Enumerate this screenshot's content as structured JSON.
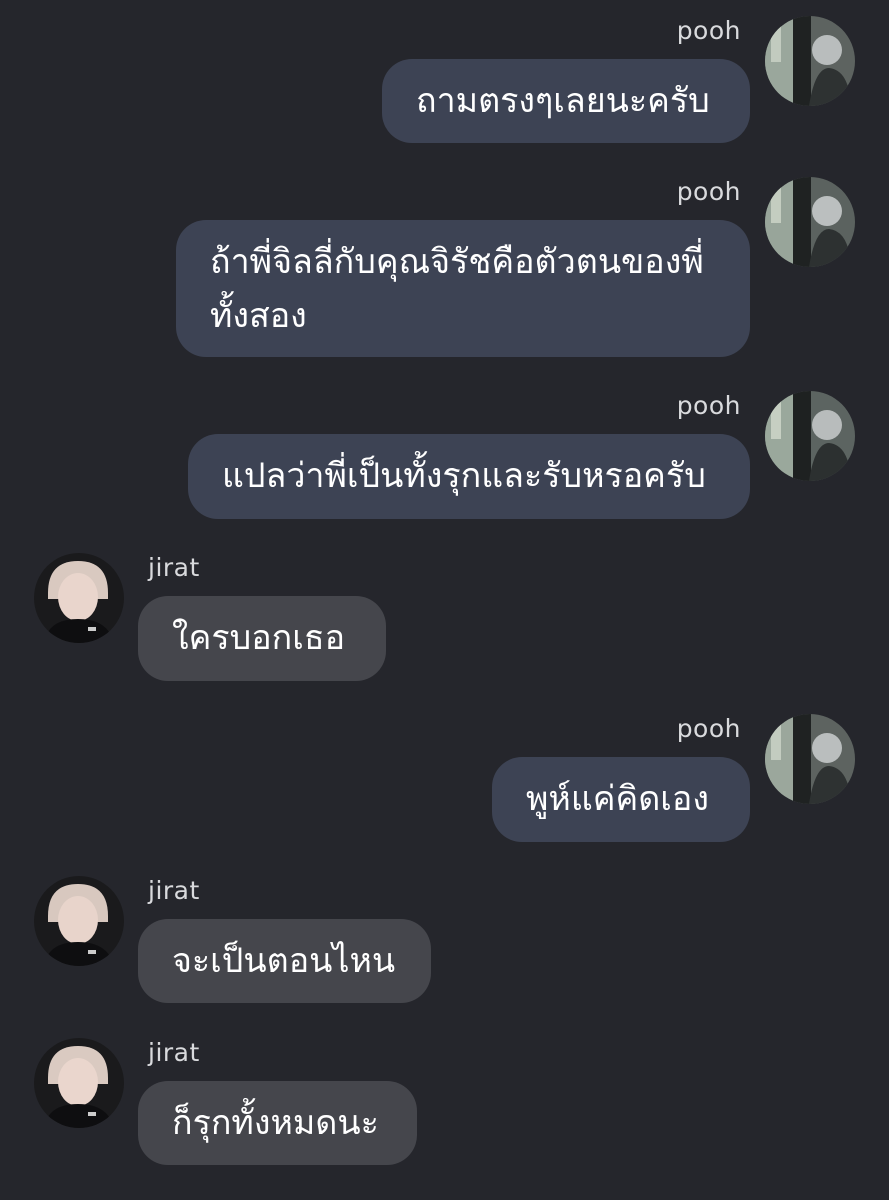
{
  "messages": [
    {
      "sender": "pooh",
      "direction": "out",
      "text": "ถามตรงๆเลยนะครับ"
    },
    {
      "sender": "pooh",
      "direction": "out",
      "text": "ถ้าพี่จิลลี่กับคุณจิรัชคือตัวตนของพี่ทั้งสอง"
    },
    {
      "sender": "pooh",
      "direction": "out",
      "text": "แปลว่าพี่เป็นทั้งรุกและรับหรอครับ"
    },
    {
      "sender": "jirat",
      "direction": "in",
      "text": "ใครบอกเธอ"
    },
    {
      "sender": "pooh",
      "direction": "out",
      "text": "พูห์แค่คิดเอง"
    },
    {
      "sender": "jirat",
      "direction": "in",
      "text": "จะเป็นตอนไหน"
    },
    {
      "sender": "jirat",
      "direction": "in",
      "text": "ก็รุกทั้งหมดนะ"
    }
  ],
  "colors": {
    "background": "#25262c",
    "outgoing_bubble": "#3d4354",
    "incoming_bubble": "#45464c",
    "text": "#ffffff",
    "sender_name": "#d9dadd"
  },
  "icons": {
    "pooh_avatar": "avatar-photo",
    "jirat_avatar": "avatar-photo"
  }
}
